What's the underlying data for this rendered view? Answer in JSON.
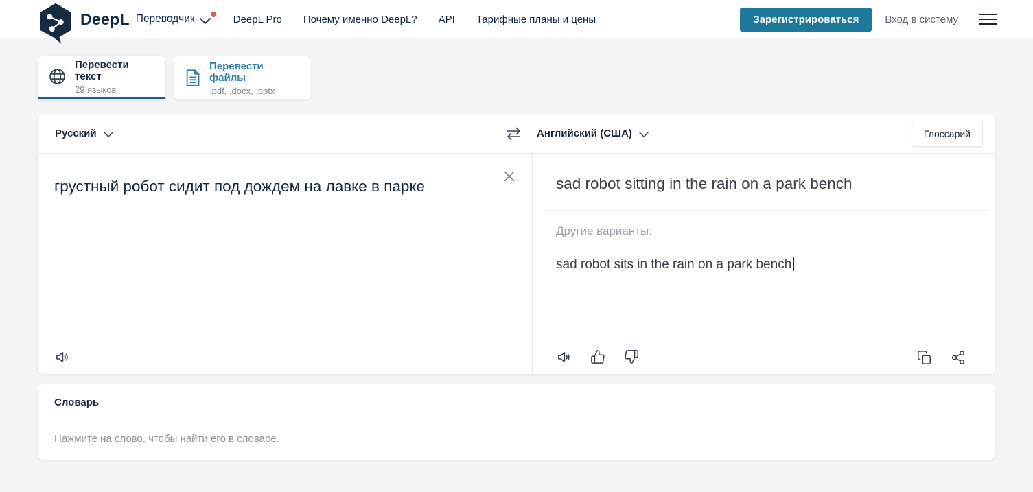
{
  "header": {
    "brand": "DeepL",
    "product_label": "Переводчик",
    "nav_items": [
      {
        "label": "DeepL Pro"
      },
      {
        "label": "Почему именно DeepL?"
      },
      {
        "label": "API"
      },
      {
        "label": "Тарифные планы и цены"
      }
    ],
    "signup_label": "Зарегистрироваться",
    "login_label": "Вход в систему"
  },
  "tabs": {
    "translate_text": {
      "title": "Перевести текст",
      "subtitle": "29 языков"
    },
    "translate_files": {
      "title": "Перевести файлы",
      "subtitle": ".pdf, .docx, .pptx"
    }
  },
  "translator": {
    "source_language": "Русский",
    "target_language": "Английский (США)",
    "glossary_label": "Глоссарий",
    "source_text": "грустный робот сидит под дождем на лавке в парке",
    "translation": "sad robot sitting in the rain on a park bench",
    "alternatives_label": "Другие варианты:",
    "alternative_1": "sad robot sits in the rain on a park bench"
  },
  "dictionary": {
    "title": "Словарь",
    "hint": "Нажмите на слово, чтобы найти его в словаре."
  },
  "colors": {
    "brand_navy": "#0f2b46",
    "accent_button": "#1d7a9d",
    "active_tab_underline": "#19618a",
    "link_blue": "#2e7ea6",
    "page_background": "#f4f4f5",
    "muted_text": "#8d939b",
    "notification_dot": "#dd5a5f"
  }
}
